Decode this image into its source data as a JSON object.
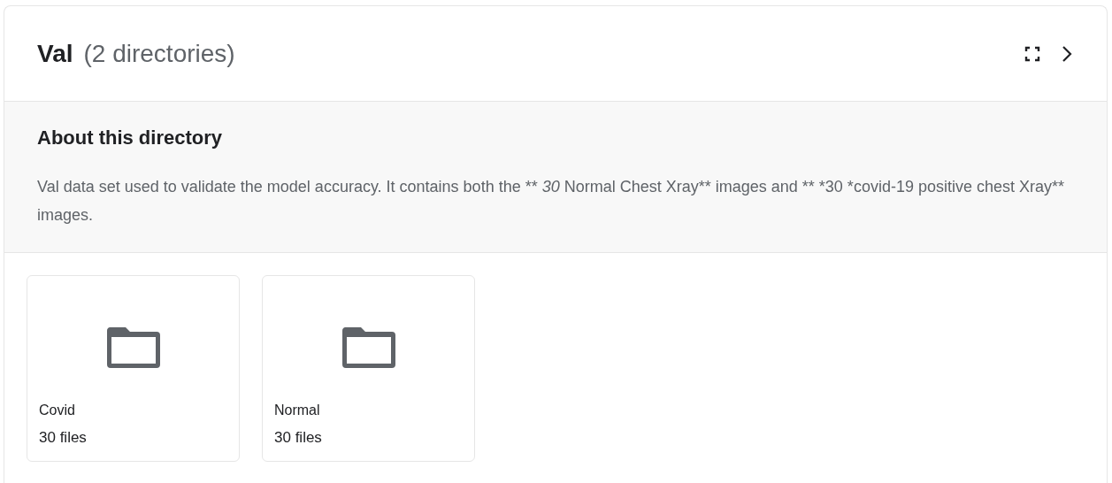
{
  "header": {
    "title": "Val",
    "count": "(2 directories)"
  },
  "about": {
    "heading": "About this directory",
    "description": [
      {
        "text": "Val data set used to validate the model accuracy. It contains both the ** ",
        "italic": false
      },
      {
        "text": "30",
        "italic": true
      },
      {
        "text": " Normal Chest Xray** images and ** *30 *covid-19 positive chest Xray** images.",
        "italic": false
      }
    ]
  },
  "folders": [
    {
      "name": "Covid",
      "files": "30 files"
    },
    {
      "name": "Normal",
      "files": "30 files"
    }
  ]
}
